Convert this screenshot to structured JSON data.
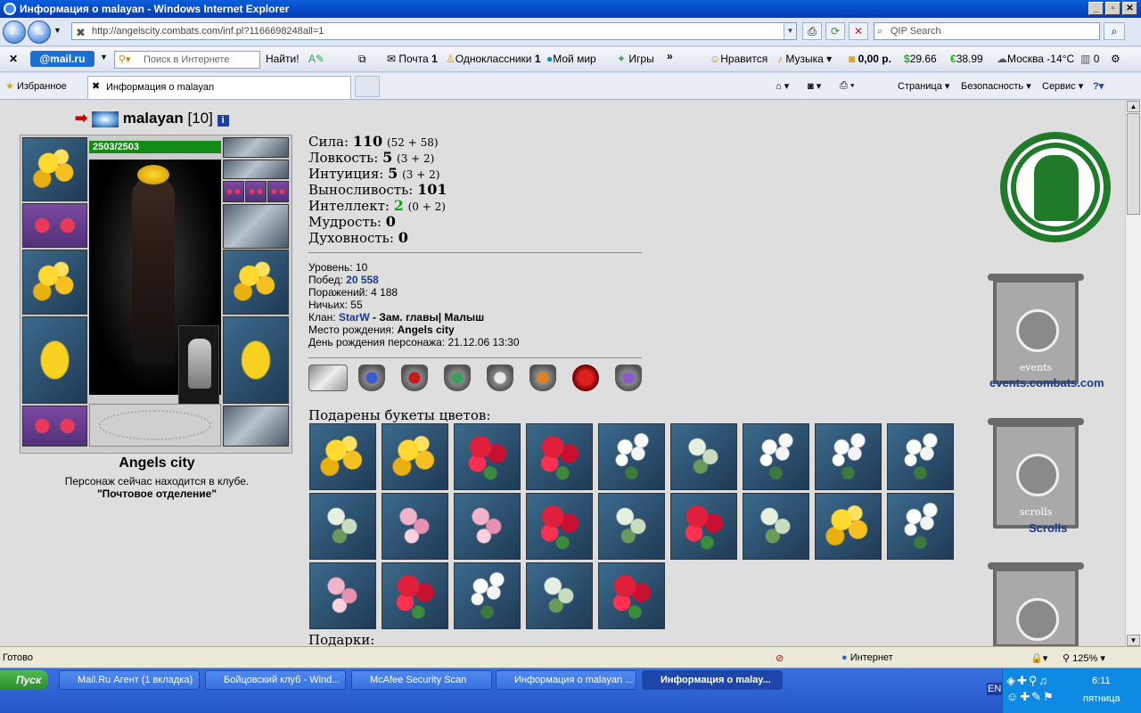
{
  "window": {
    "title": "Информация о malayan - Windows Internet Explorer"
  },
  "address": {
    "url": "http://angelscity.combats.com/inf.pl?1166698248all=1",
    "search_placeholder": "QIP Search"
  },
  "toolbar": {
    "mailru": "@mail.ru",
    "search_placeholder": "Поиск в Интернете",
    "find": "Найти!",
    "mail": "Почта",
    "mail_count": "1",
    "ok": "Одноклассники",
    "ok_count": "1",
    "moymir": "Мой мир",
    "games": "Игры",
    "like": "Нравится",
    "music": "Музыка",
    "balance": "0,00 р.",
    "usd": "29.66",
    "eur": "38.99",
    "weather": "Москва -14°C",
    "counter": "0"
  },
  "favbar": {
    "favorites": "Избранное",
    "tab_title": "Информация о malayan",
    "page": "Страница",
    "security": "Безопасность",
    "service": "Сервис"
  },
  "character": {
    "name": "malayan",
    "level_tag": "[10]",
    "hp": "2503/2503",
    "city": "Angels city",
    "club_status": "Персонаж сейчас находится в клубе.",
    "club_location": "\"Почтовое отделение\""
  },
  "stats": [
    {
      "label": "Сила:",
      "value": "110",
      "bonus": "(52 + 58)"
    },
    {
      "label": "Ловкость:",
      "value": "5",
      "bonus": "(3 + 2)"
    },
    {
      "label": "Интуиция:",
      "value": "5",
      "bonus": "(3 + 2)"
    },
    {
      "label": "Выносливость:",
      "value": "101",
      "bonus": ""
    },
    {
      "label": "Интеллект:",
      "value": "2",
      "bonus": "(0 + 2)"
    },
    {
      "label": "Мудрость:",
      "value": "0",
      "bonus": ""
    },
    {
      "label": "Духовность:",
      "value": "0",
      "bonus": ""
    }
  ],
  "info": {
    "level_label": "Уровень:",
    "level": "10",
    "wins_label": "Побед:",
    "wins": "20 558",
    "losses_label": "Поражений:",
    "losses": "4 188",
    "draws_label": "Ничьих:",
    "draws": "55",
    "clan_label": "Клан:",
    "clan": "StarW",
    "clan_role": "- Зам. главы| Малыш",
    "birthplace_label": "Место рождения:",
    "birthplace": "Angels city",
    "birthday_label": "День рождения персонажа:",
    "birthday": "21.12.06 13:30"
  },
  "flowers_title": "Подарены букеты цветов:",
  "flowers": [
    "y",
    "y",
    "r",
    "r",
    "w",
    "g",
    "w",
    "w",
    "w",
    "g",
    "p",
    "p",
    "r",
    "g",
    "r",
    "g",
    "y",
    "w",
    "p",
    "r",
    "w",
    "g",
    "r"
  ],
  "gifts_title": "Подарки:",
  "links": {
    "events": "events.combats.com",
    "events_label": "events",
    "scrolls": "Scrolls",
    "scrolls_label": "scrolls"
  },
  "status": {
    "ready": "Готово",
    "zone": "Интернет",
    "zoom": "125%"
  },
  "taskbar": {
    "start": "Пуск",
    "tasks": [
      "Mail.Ru Агент (1 вкладка)",
      "Бойцовский клуб - Wind...",
      "McAfee Security Scan",
      "Информация о malayan ...",
      "Информация о malay..."
    ],
    "lang": "EN",
    "time": "6:11",
    "day": "пятница"
  }
}
